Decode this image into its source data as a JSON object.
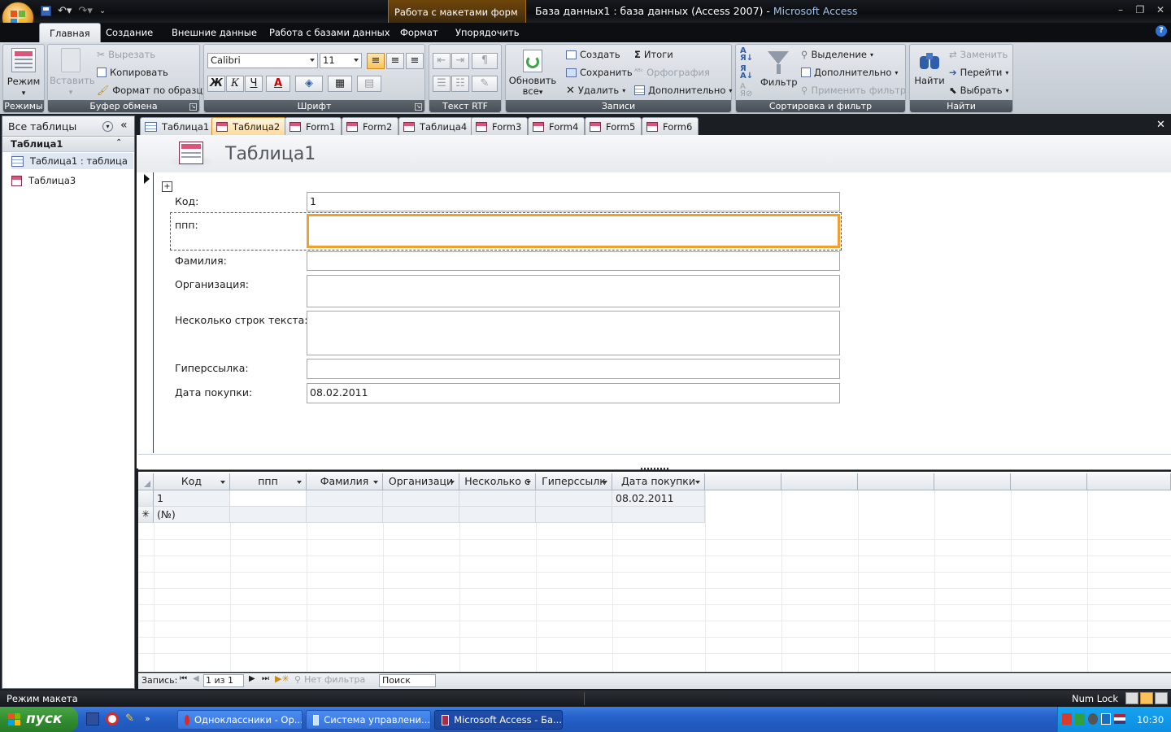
{
  "titlebar": {
    "context_tab_label": "Работа с макетами форм",
    "title_main": "База данных1 : база данных (Access 2007) - ",
    "title_app": "Microsoft Access"
  },
  "ribbon_tabs": [
    "Главная",
    "Создание",
    "Внешние данные",
    "Работа с базами данных",
    "Формат",
    "Упорядочить"
  ],
  "ribbon": {
    "modes": {
      "label": "Режим",
      "group": "Режимы"
    },
    "clipboard": {
      "paste": "Вставить",
      "cut": "Вырезать",
      "copy": "Копировать",
      "format_painter": "Формат по образцу",
      "group": "Буфер обмена"
    },
    "font": {
      "family": "Calibri",
      "size": "11",
      "bold": "Ж",
      "italic": "К",
      "underline": "Ч",
      "color_letter": "A",
      "group": "Шрифт"
    },
    "rtf": {
      "group": "Текст RTF"
    },
    "records": {
      "refresh": "Обновить",
      "refresh2": "все",
      "new": "Создать",
      "save": "Сохранить",
      "delete": "Удалить",
      "totals": "Итоги",
      "spelling": "Орфография",
      "more": "Дополнительно",
      "group": "Записи"
    },
    "sort": {
      "filter": "Фильтр",
      "selection": "Выделение",
      "advanced": "Дополнительно",
      "apply": "Применить фильтр",
      "group": "Сортировка и фильтр"
    },
    "find": {
      "find": "Найти",
      "replace": "Заменить",
      "goto": "Перейти",
      "select": "Выбрать",
      "group": "Найти"
    }
  },
  "nav": {
    "title": "Все таблицы",
    "group": "Таблица1",
    "items": [
      "Таблица1 : таблица",
      "Таблица3"
    ]
  },
  "doc_tabs": [
    "Таблица1",
    "Таблица2",
    "Form1",
    "Form2",
    "Таблица4",
    "Form3",
    "Form4",
    "Form5",
    "Form6"
  ],
  "form": {
    "title": "Таблица1",
    "fields": [
      {
        "label": "Код:",
        "value": "1"
      },
      {
        "label": "ппп:",
        "value": ""
      },
      {
        "label": "Фамилия:",
        "value": ""
      },
      {
        "label": "Организация:",
        "value": ""
      },
      {
        "label": "Несколько строк текста:",
        "value": ""
      },
      {
        "label": "Гиперссылка:",
        "value": ""
      },
      {
        "label": "Дата покупки:",
        "value": "08.02.2011"
      }
    ]
  },
  "datasheet": {
    "columns": [
      "Код",
      "ппп",
      "Фамилия",
      "Организаци",
      "Несколько с",
      "Гиперссылк",
      "Дата покупки"
    ],
    "rows": [
      [
        "1",
        "",
        "",
        "",
        "",
        "",
        "08.02.2011"
      ]
    ],
    "new_row": "(№)"
  },
  "recnav": {
    "label": "Запись:",
    "position": "1 из 1",
    "filter": "Нет фильтра",
    "search": "Поиск"
  },
  "status": {
    "left": "Режим макета",
    "numlock": "Num Lock"
  },
  "taskbar": {
    "start": "пуск",
    "tasks": [
      "Одноклассники - Op...",
      "Система управлени...",
      "Microsoft Access - Ба..."
    ],
    "clock": "10:30"
  },
  "colors": {
    "accent_orange": "#f0a030",
    "title_dark": "#0b0d10",
    "taskbar_blue": "#2561c9"
  }
}
